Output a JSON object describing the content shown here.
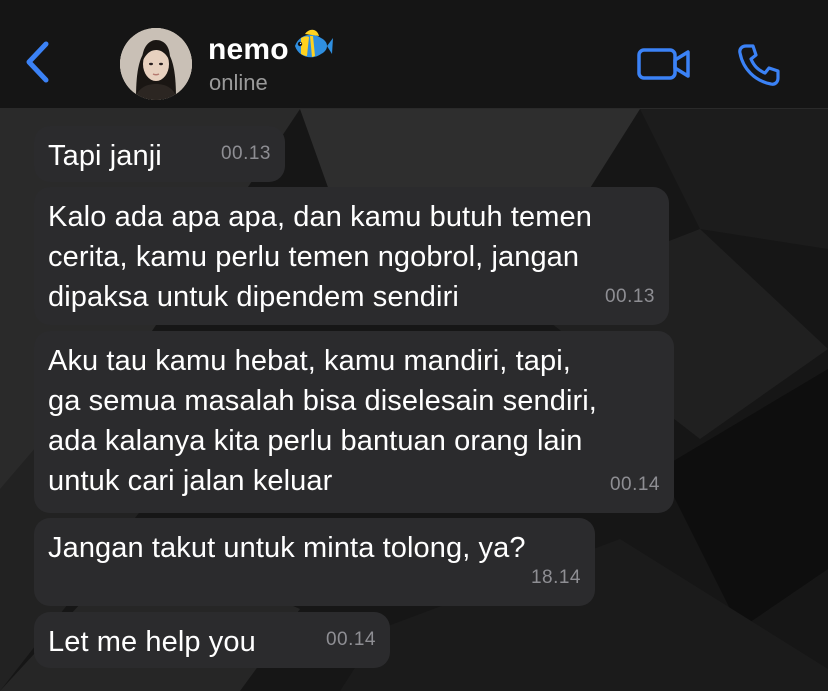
{
  "header": {
    "contact_name": "nemo",
    "status": "online"
  },
  "icons": {
    "back": "chevron-left-icon",
    "video": "video-camera-icon",
    "call": "phone-icon",
    "name_emoji": "tropical-fish-icon"
  },
  "colors": {
    "accent": "#3b82f6",
    "bubble": "#2b2b2d",
    "header_bg": "#151515",
    "timestamp": "#8e8e93"
  },
  "messages": [
    {
      "text": "Tapi janji",
      "time": "00.13"
    },
    {
      "text": "Kalo ada apa apa, dan kamu butuh temen\ncerita, kamu perlu temen ngobrol, jangan\ndipaksa untuk dipendem sendiri",
      "time": "00.13"
    },
    {
      "text": "Aku tau kamu hebat, kamu mandiri, tapi,\nga semua masalah bisa diselesain sendiri,\nada kalanya kita perlu bantuan orang lain\nuntuk cari jalan keluar",
      "time": "00.14"
    },
    {
      "text": "Jangan takut untuk minta tolong, ya?",
      "time": "18.14"
    },
    {
      "text": "Let me help you",
      "time": "00.14"
    }
  ]
}
